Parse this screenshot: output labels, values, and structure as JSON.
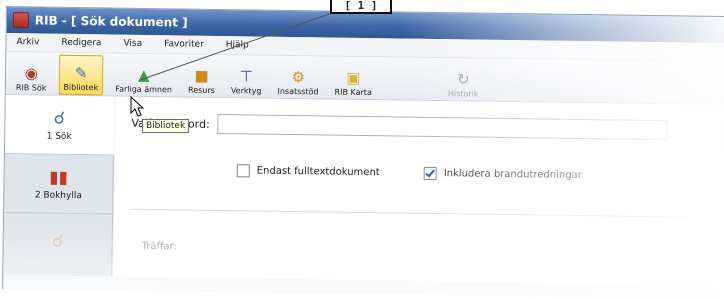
{
  "window": {
    "title": "RIB - [ Sök dokument ]"
  },
  "callout": {
    "label": "[ 1 ]"
  },
  "menubar": {
    "items": [
      "Arkiv",
      "Redigera",
      "Visa",
      "Favoriter",
      "Hjälp"
    ]
  },
  "toolbar": {
    "buttons": [
      {
        "label": "RIB Sök",
        "icon": "search-person-icon"
      },
      {
        "label": "Bibliotek",
        "icon": "library-icon"
      },
      {
        "label": "Farliga ämnen",
        "icon": "flask-icon"
      },
      {
        "label": "Resurs",
        "icon": "resource-icon"
      },
      {
        "label": "Verktyg",
        "icon": "tools-icon"
      },
      {
        "label": "Insatsstöd",
        "icon": "support-icon"
      },
      {
        "label": "RIB Karta",
        "icon": "map-icon"
      },
      {
        "label": "Historik",
        "icon": "history-icon"
      }
    ],
    "tooltip": "Bibliotek"
  },
  "leftnav": {
    "items": [
      {
        "label": "1 Sök",
        "icon": "search-icon"
      },
      {
        "label": "2 Bokhylla",
        "icon": "bookshelf-icon"
      },
      {
        "label": "",
        "icon": "search-icon"
      }
    ]
  },
  "search": {
    "label": "Valfria sökord:",
    "value": ""
  },
  "options": {
    "fulltext": {
      "label": "Endast fulltextdokument",
      "checked": false
    },
    "brand": {
      "label": "Inkludera brandutredningar",
      "checked": true
    }
  },
  "results": {
    "label": "Träffar:"
  }
}
